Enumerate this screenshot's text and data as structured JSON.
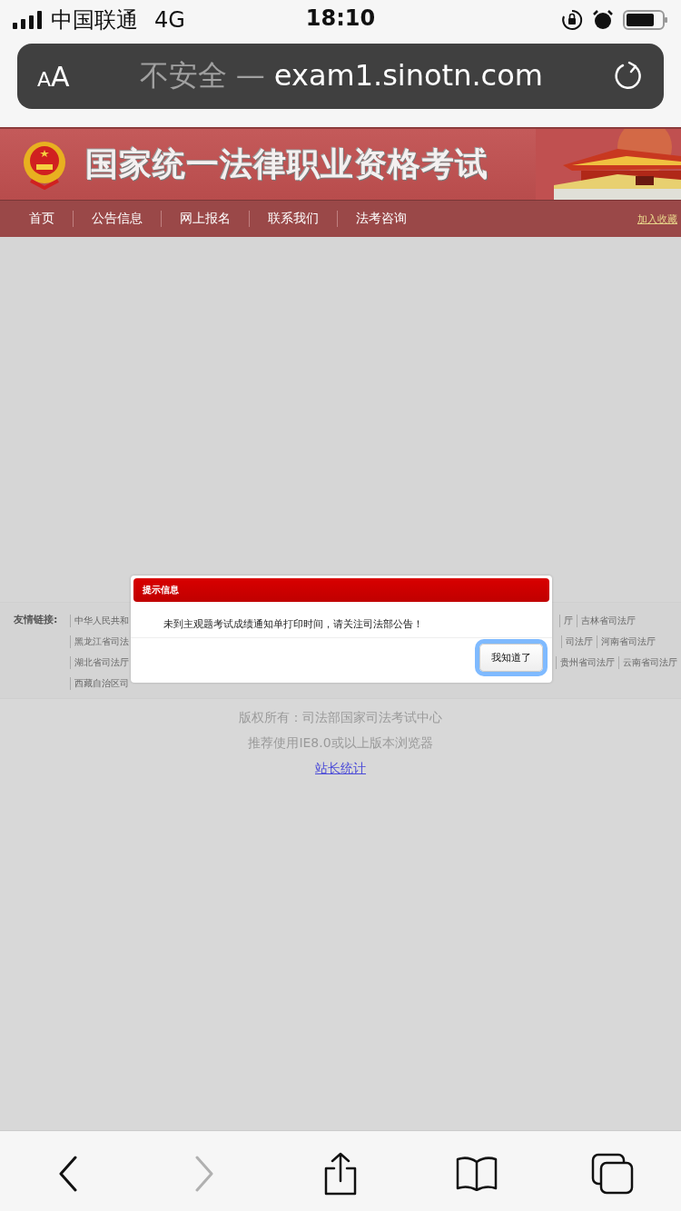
{
  "status_bar": {
    "carrier": "中国联通",
    "network": "4G",
    "time": "18:10"
  },
  "address_bar": {
    "text_size": "AA",
    "security": "不安全 —",
    "url": "exam1.sinotn.com"
  },
  "banner": {
    "title": "国家统一法律职业资格考试"
  },
  "nav": {
    "items": [
      {
        "label": "首页"
      },
      {
        "label": "公告信息"
      },
      {
        "label": "网上报名"
      },
      {
        "label": "联系我们"
      },
      {
        "label": "法考咨询"
      }
    ],
    "bookmark": "加入收藏"
  },
  "links": {
    "label": "友情链接:",
    "rows": [
      {
        "left": [
          "中华人民共和"
        ],
        "right": [
          "厅",
          "吉林省司法厅"
        ]
      },
      {
        "left": [
          "黑龙江省司法"
        ],
        "right": [
          "司法厅",
          "河南省司法厅"
        ]
      },
      {
        "left": [
          "湖北省司法厅"
        ],
        "right": [
          "贵州省司法厅",
          "云南省司法厅"
        ]
      },
      {
        "left": [
          "西藏自治区司"
        ],
        "right": []
      }
    ]
  },
  "footer": {
    "copyright": "版权所有：司法部国家司法考试中心",
    "browser_note": "推荐使用IE8.0或以上版本浏览器",
    "stats_link": "站长统计"
  },
  "dialog": {
    "title": "提示信息",
    "message": "未到主观题考试成绩通知单打印时间，请关注司法部公告！",
    "button": {
      "label": "我知道了",
      "focused": true
    }
  },
  "toolbar": [
    {
      "kind": "back",
      "disabled": false
    },
    {
      "kind": "forward",
      "disabled": true
    },
    {
      "kind": "share",
      "disabled": false
    },
    {
      "kind": "bookmarks",
      "disabled": false
    },
    {
      "kind": "tabs",
      "disabled": false
    }
  ]
}
